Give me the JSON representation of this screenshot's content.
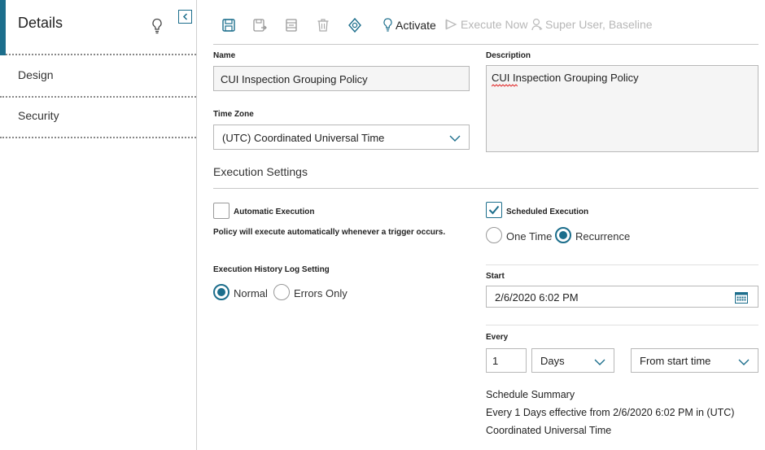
{
  "sidebar": {
    "title": "Details",
    "items": [
      {
        "label": "Design"
      },
      {
        "label": "Security"
      }
    ]
  },
  "toolbar": {
    "icons": [
      "save-icon",
      "save-as-icon",
      "copy-icon",
      "delete-icon",
      "validate-icon"
    ],
    "activate_label": "Activate",
    "execute_label": "Execute Now",
    "user_label": "Super User, Baseline"
  },
  "form": {
    "name_label": "Name",
    "name_value": "CUI Inspection Grouping Policy",
    "description_label": "Description",
    "description_value": "CUI Inspection Grouping Policy",
    "timezone_label": "Time Zone",
    "timezone_value": "(UTC) Coordinated Universal Time"
  },
  "execution": {
    "section_title": "Execution Settings",
    "automatic_label": "Automatic Execution",
    "automatic_checked": false,
    "automatic_note": "Policy will execute automatically whenever a trigger occurs.",
    "scheduled_label": "Scheduled Execution",
    "scheduled_checked": true,
    "schedule_options": [
      "One Time",
      "Recurrence"
    ],
    "schedule_selected": "Recurrence",
    "history_label": "Execution History Log Setting",
    "history_options": [
      "Normal",
      "Errors Only"
    ],
    "history_selected": "Normal",
    "start_label": "Start",
    "start_value": "2/6/2020 6:02 PM",
    "every_label": "Every",
    "every_value": "1",
    "every_unit": "Days",
    "every_from": "From start time",
    "summary_title": "Schedule Summary",
    "summary_line1": "Every 1 Days effective from 2/6/2020 6:02 PM in (UTC)",
    "summary_line2": "Coordinated Universal Time"
  },
  "colors": {
    "accent": "#1c6e8c",
    "disabled": "#b7b7b7"
  }
}
